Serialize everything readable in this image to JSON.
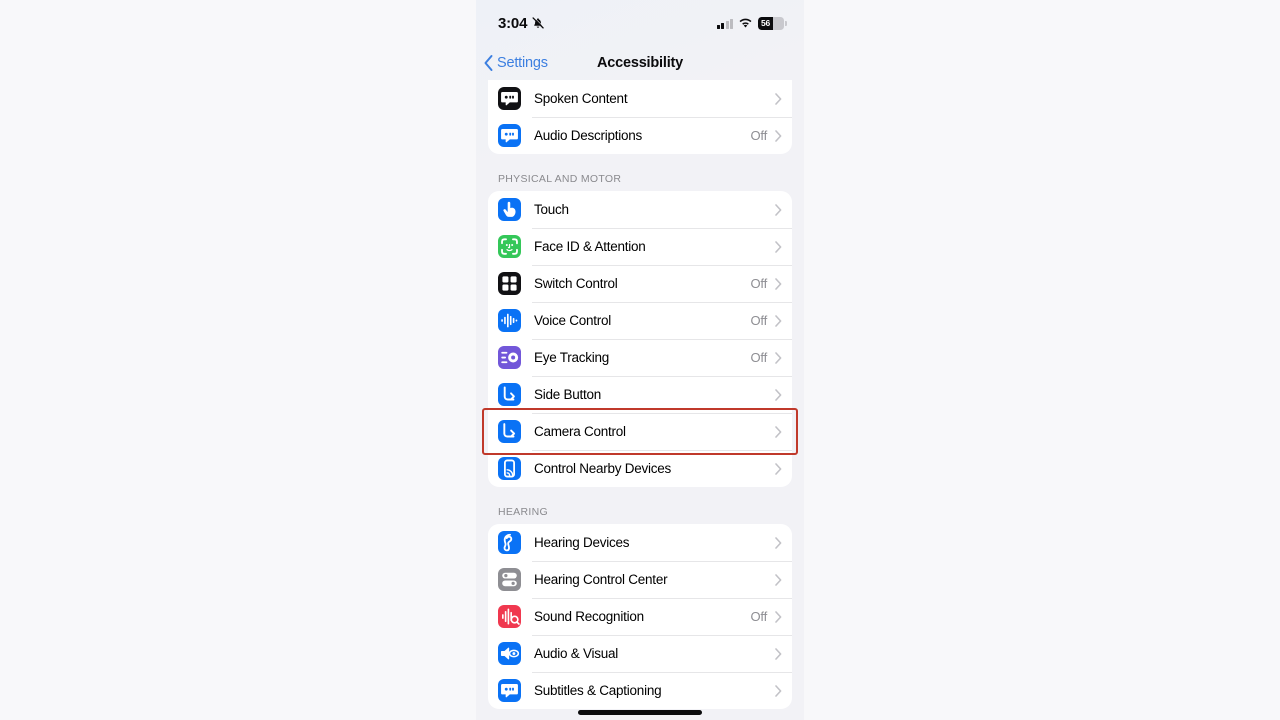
{
  "status_bar": {
    "time": "3:04",
    "silent_icon": "bell-slash-icon",
    "cellular_icon": "cellular-bars-icon",
    "wifi_icon": "wifi-icon",
    "battery_percent": "56",
    "battery_level": 56
  },
  "nav": {
    "back_label": "Settings",
    "title": "Accessibility"
  },
  "sections": [
    {
      "header": "",
      "cut_top": true,
      "rows": [
        {
          "label": "Spoken Content",
          "value": "",
          "icon": "spoken-content-icon",
          "icon_bg": "#111114"
        },
        {
          "label": "Audio Descriptions",
          "value": "Off",
          "icon": "audio-descriptions-icon",
          "icon_bg": "#0a72f5"
        }
      ]
    },
    {
      "header": "PHYSICAL AND MOTOR",
      "cut_top": false,
      "rows": [
        {
          "label": "Touch",
          "value": "",
          "icon": "touch-hand-icon",
          "icon_bg": "#0a72f5"
        },
        {
          "label": "Face ID & Attention",
          "value": "",
          "icon": "face-id-icon",
          "icon_bg": "#34c759"
        },
        {
          "label": "Switch Control",
          "value": "Off",
          "icon": "switch-control-icon",
          "icon_bg": "#111114"
        },
        {
          "label": "Voice Control",
          "value": "Off",
          "icon": "voice-control-icon",
          "icon_bg": "#0a72f5"
        },
        {
          "label": "Eye Tracking",
          "value": "Off",
          "icon": "eye-tracking-icon",
          "icon_bg": "#7257d9"
        },
        {
          "label": "Side Button",
          "value": "",
          "icon": "side-button-icon",
          "icon_bg": "#0a72f5"
        },
        {
          "label": "Camera Control",
          "value": "",
          "icon": "camera-control-icon",
          "icon_bg": "#0a72f5",
          "highlighted": true
        },
        {
          "label": "Control Nearby Devices",
          "value": "",
          "icon": "nearby-devices-icon",
          "icon_bg": "#0a72f5"
        }
      ]
    },
    {
      "header": "HEARING",
      "cut_top": false,
      "rows": [
        {
          "label": "Hearing Devices",
          "value": "",
          "icon": "hearing-devices-icon",
          "icon_bg": "#0a72f5"
        },
        {
          "label": "Hearing Control Center",
          "value": "",
          "icon": "hearing-control-center-icon",
          "icon_bg": "#8e8e93"
        },
        {
          "label": "Sound Recognition",
          "value": "Off",
          "icon": "sound-recognition-icon",
          "icon_bg": "#f0384f"
        },
        {
          "label": "Audio & Visual",
          "value": "",
          "icon": "audio-visual-icon",
          "icon_bg": "#0a72f5"
        },
        {
          "label": "Subtitles & Captioning",
          "value": "",
          "icon": "subtitles-captioning-icon",
          "icon_bg": "#0a72f5"
        }
      ]
    }
  ],
  "highlight": {
    "color": "#c0392b",
    "target": "Camera Control"
  },
  "home_indicator": "home-indicator"
}
